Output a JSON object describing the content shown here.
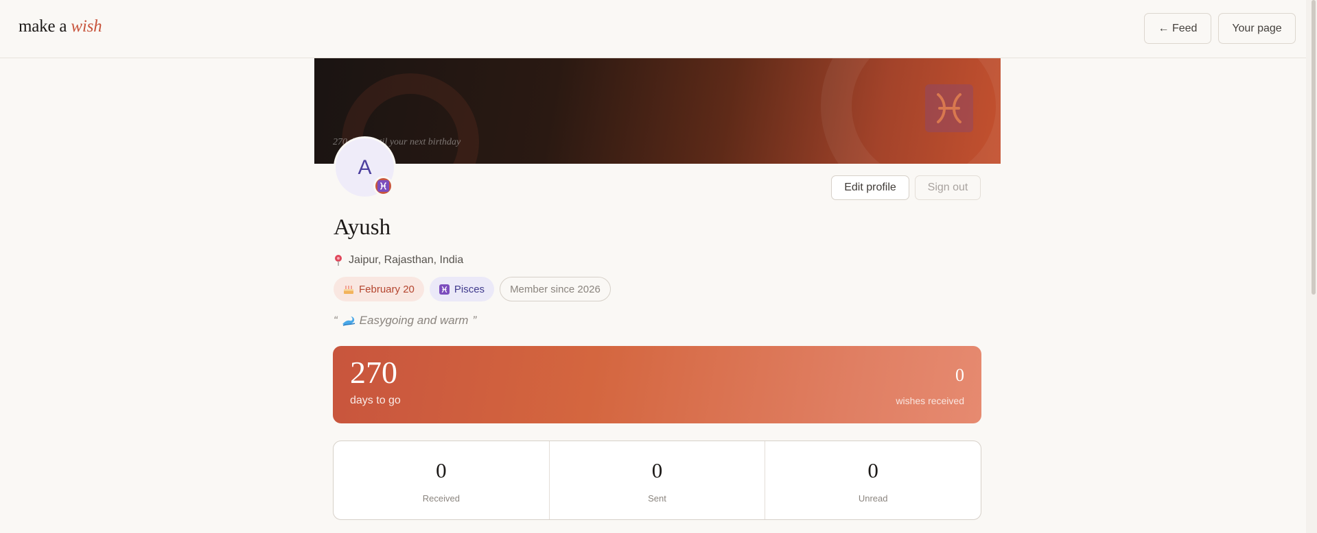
{
  "header": {
    "logo_plain": "make a",
    "logo_accent": "wish",
    "feed_label": "← Feed",
    "your_page_label": "Your page"
  },
  "banner": {
    "countdown_note": "270 days until your next birthday",
    "zodiac_icon": "pisces-icon"
  },
  "profile": {
    "avatar_initial": "A",
    "name": "Ayush",
    "location": "Jaipur, Rajasthan, India",
    "birthday": "February 20",
    "sign": "Pisces",
    "member_since": "Member since 2026",
    "quote_open": "“",
    "quote_text": "Easygoing and warm",
    "quote_close": "”"
  },
  "actions": {
    "edit_label": "Edit profile",
    "signout_label": "Sign out"
  },
  "countdown": {
    "days": "270",
    "days_label": "days to go",
    "wishes": "0",
    "wishes_label": "wishes received"
  },
  "stats": [
    {
      "value": "0",
      "label": "Received"
    },
    {
      "value": "0",
      "label": "Sent"
    },
    {
      "value": "0",
      "label": "Unread"
    }
  ],
  "colors": {
    "accent": "#c8553d",
    "background": "#faf8f5",
    "sign_purple": "#7c4dbd"
  }
}
